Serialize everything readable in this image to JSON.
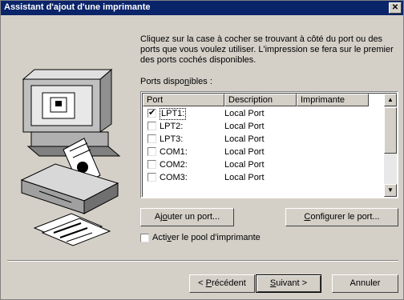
{
  "window": {
    "title": "Assistant d'ajout d'une imprimante",
    "close_glyph": "✕"
  },
  "intro": "Cliquez sur la case à cocher se trouvant à côté du port ou des ports que vous voulez utiliser. L'impression se fera sur le premier des ports cochés disponibles.",
  "ports_label": {
    "before": "Ports dispo",
    "accel": "n",
    "after": "ibles :"
  },
  "columns": [
    "Port",
    "Description",
    "Imprimante"
  ],
  "ports": [
    {
      "name": "LPT1:",
      "description": "Local Port",
      "checked": "✔"
    },
    {
      "name": "LPT2:",
      "description": "Local Port",
      "checked": ""
    },
    {
      "name": "LPT3:",
      "description": "Local Port",
      "checked": ""
    },
    {
      "name": "COM1:",
      "description": "Local Port",
      "checked": ""
    },
    {
      "name": "COM2:",
      "description": "Local Port",
      "checked": ""
    },
    {
      "name": "COM3:",
      "description": "Local Port",
      "checked": ""
    }
  ],
  "scroll": {
    "up": "▲",
    "down": "▼"
  },
  "buttons": {
    "add_port": {
      "before": "Aj",
      "accel": "o",
      "after": "uter un port..."
    },
    "configure_port": {
      "before": "",
      "accel": "C",
      "after": "onfigurer le port..."
    },
    "previous": {
      "before": "< ",
      "accel": "P",
      "after": "récédent"
    },
    "next": {
      "before": "",
      "accel": "S",
      "after": "uivant >"
    },
    "cancel": "Annuler"
  },
  "pool": {
    "before": "Acti",
    "accel": "v",
    "after": "er le pool d'imprimante"
  },
  "icons": [
    "computer-monitor-icon",
    "printer-icon",
    "printed-pages-icon"
  ]
}
